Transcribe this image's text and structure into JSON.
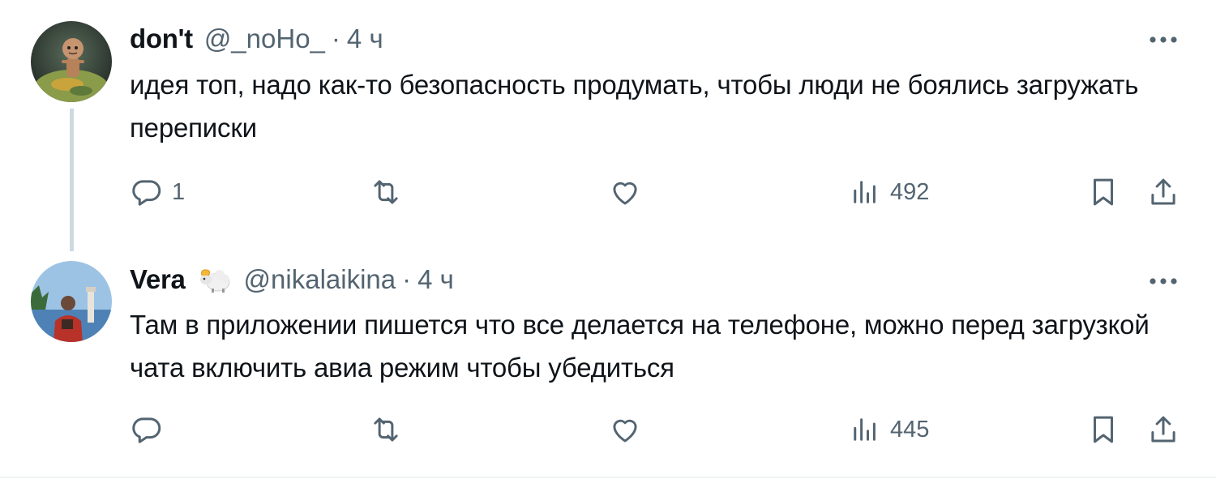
{
  "tweets": [
    {
      "name": "don't",
      "handle": "@_noHo_",
      "separator": "·",
      "time": "4 ч",
      "text": "идея топ, надо как-то безопасность продумать, чтобы люди не боялись загружать переписки",
      "reply_count": "1",
      "views": "492",
      "emoji": null
    },
    {
      "name": "Vera",
      "handle": "@nikalaikina",
      "separator": "·",
      "time": "4 ч",
      "text": "Там в приложении пишется что все делается на телефоне, можно перед загрузкой чата включить авиа режим чтобы убедиться",
      "reply_count": "",
      "views": "445",
      "emoji": "ram-emoji"
    }
  ],
  "colors": {
    "text": "#0f1419",
    "secondary": "#536471",
    "thread_line": "#cfd9de"
  }
}
